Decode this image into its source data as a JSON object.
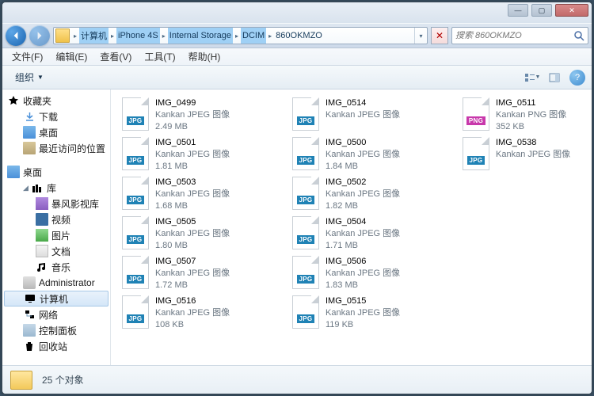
{
  "window_controls": {
    "min": "—",
    "max": "▢",
    "close": "✕"
  },
  "breadcrumb": {
    "items": [
      "计算机",
      "iPhone 4S",
      "Internal Storage",
      "DCIM",
      "860OKMZO"
    ]
  },
  "search": {
    "placeholder": "搜索 860OKMZO"
  },
  "menubar": {
    "file": "文件(F)",
    "edit": "编辑(E)",
    "view": "查看(V)",
    "tools": "工具(T)",
    "help": "帮助(H)"
  },
  "toolbar": {
    "organize": "组织"
  },
  "sidebar": {
    "favorites": {
      "label": "收藏夹",
      "downloads": "下载",
      "desktop": "桌面",
      "recent": "最近访问的位置"
    },
    "desktop": {
      "label": "桌面",
      "libraries": "库",
      "baofeng": "暴风影视库",
      "video": "视频",
      "pictures": "图片",
      "documents": "文档",
      "music": "音乐",
      "admin": "Administrator",
      "computer": "计算机",
      "network": "网络",
      "control": "控制面板",
      "recycle": "回收站"
    }
  },
  "files": [
    {
      "name": "IMG_0499",
      "type": "Kankan JPEG 图像",
      "size": "2.49 MB",
      "ext": "jpg"
    },
    {
      "name": "IMG_0501",
      "type": "Kankan JPEG 图像",
      "size": "1.81 MB",
      "ext": "jpg"
    },
    {
      "name": "IMG_0503",
      "type": "Kankan JPEG 图像",
      "size": "1.68 MB",
      "ext": "jpg"
    },
    {
      "name": "IMG_0505",
      "type": "Kankan JPEG 图像",
      "size": "1.80 MB",
      "ext": "jpg"
    },
    {
      "name": "IMG_0507",
      "type": "Kankan JPEG 图像",
      "size": "1.72 MB",
      "ext": "jpg"
    },
    {
      "name": "IMG_0516",
      "type": "Kankan JPEG 图像",
      "size": "108 KB",
      "ext": "jpg"
    },
    {
      "name": "IMG_0514",
      "type": "Kankan JPEG 图像",
      "size": "",
      "ext": "jpg"
    },
    {
      "name": "IMG_0500",
      "type": "Kankan JPEG 图像",
      "size": "1.84 MB",
      "ext": "jpg"
    },
    {
      "name": "IMG_0502",
      "type": "Kankan JPEG 图像",
      "size": "1.82 MB",
      "ext": "jpg"
    },
    {
      "name": "IMG_0504",
      "type": "Kankan JPEG 图像",
      "size": "1.71 MB",
      "ext": "jpg"
    },
    {
      "name": "IMG_0506",
      "type": "Kankan JPEG 图像",
      "size": "1.83 MB",
      "ext": "jpg"
    },
    {
      "name": "IMG_0515",
      "type": "Kankan JPEG 图像",
      "size": "119 KB",
      "ext": "jpg"
    },
    {
      "name": "IMG_0511",
      "type": "Kankan PNG 图像",
      "size": "352 KB",
      "ext": "png"
    },
    {
      "name": "IMG_0538",
      "type": "Kankan JPEG 图像",
      "size": "",
      "ext": "jpg"
    }
  ],
  "status": {
    "count": "25 个对象"
  }
}
